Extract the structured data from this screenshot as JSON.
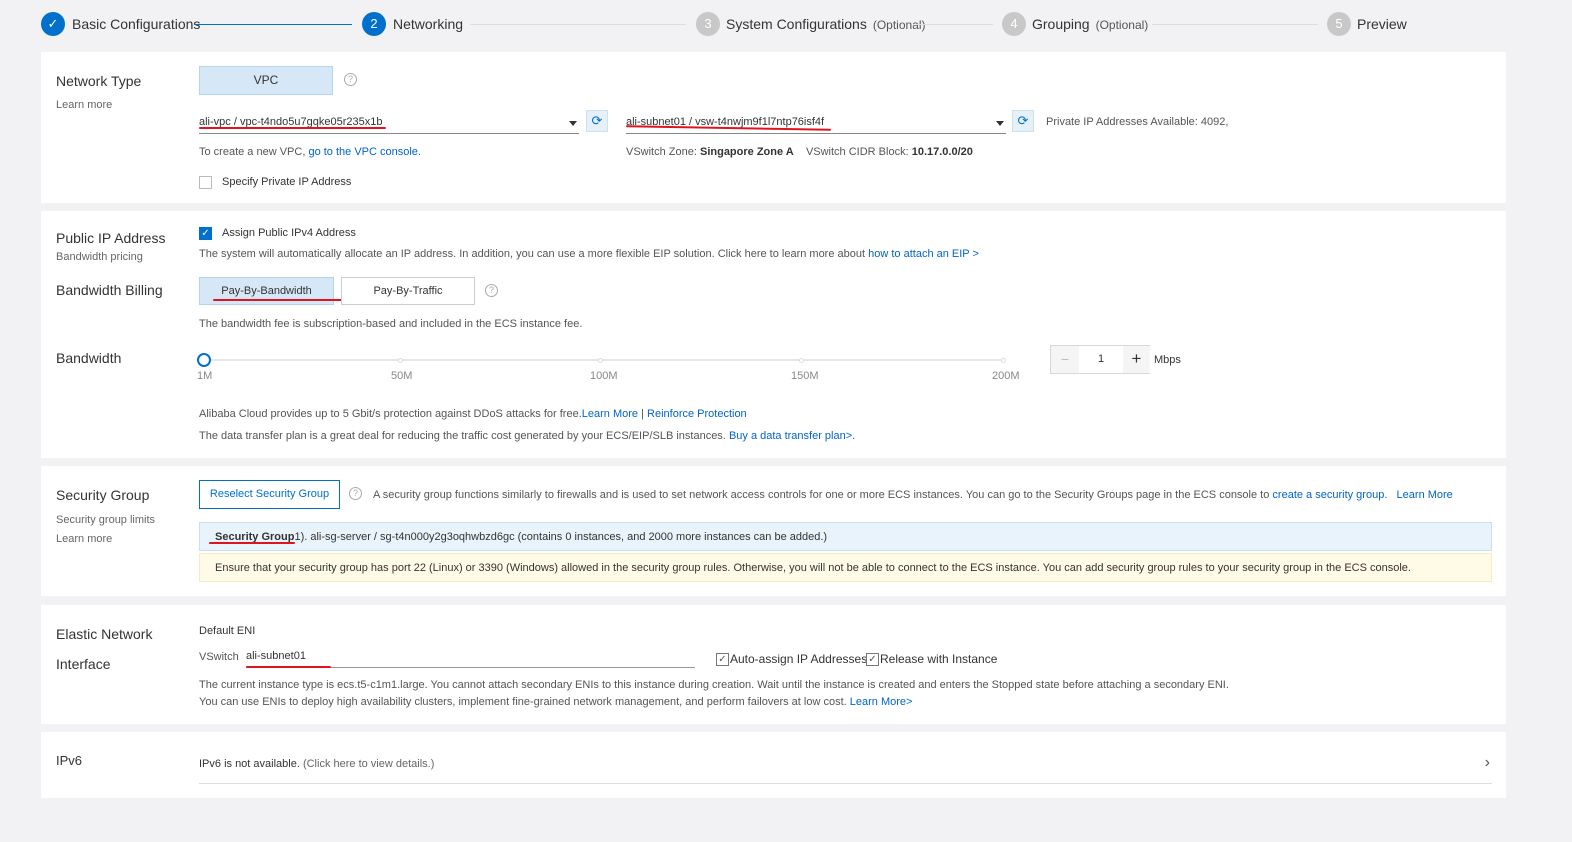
{
  "steps": [
    {
      "num": "",
      "label": "Basic Configurations",
      "optional": ""
    },
    {
      "num": "2",
      "label": "Networking",
      "optional": ""
    },
    {
      "num": "3",
      "label": "System Configurations",
      "optional": "(Optional)"
    },
    {
      "num": "4",
      "label": "Grouping",
      "optional": "(Optional)"
    },
    {
      "num": "5",
      "label": "Preview",
      "optional": ""
    }
  ],
  "network": {
    "label": "Network Type",
    "learn_more": "Learn more",
    "vpc_button": "VPC",
    "vpc_select": "ali-vpc / vpc-t4ndo5u7gqke05r235x1b",
    "vswitch_select": "ali-subnet01 / vsw-t4nwjm9f1l7ntp76isf4f",
    "private_ip_available": "Private IP Addresses Available: 4092,",
    "create_vpc_text": "To create a new VPC,",
    "create_vpc_link": "go to the VPC console.",
    "vswitch_zone_label": "VSwitch Zone:",
    "vswitch_zone_value": "Singapore Zone A",
    "vswitch_cidr_label": "VSwitch CIDR Block:",
    "vswitch_cidr_value": "10.17.0.0/20",
    "specify_private_ip": "Specify Private IP Address"
  },
  "public_ip": {
    "label": "Public IP Address",
    "bandwidth_pricing": "Bandwidth pricing",
    "assign_checkbox": "Assign Public IPv4 Address",
    "eip_text": "The system will automatically allocate an IP address. In addition, you can use a more flexible EIP solution. Click here to learn more about",
    "eip_link": "how to attach an EIP >",
    "billing_label": "Bandwidth Billing",
    "pay_by_bandwidth": "Pay-By-Bandwidth",
    "pay_by_traffic": "Pay-By-Traffic",
    "billing_note": "The bandwidth fee is subscription-based and included in the ECS instance fee.",
    "bandwidth_label": "Bandwidth",
    "slider_ticks": [
      "1M",
      "50M",
      "100M",
      "150M",
      "200M"
    ],
    "bandwidth_value": "1",
    "bandwidth_unit": "Mbps",
    "minus": "−",
    "plus": "+",
    "ddos_text": "Alibaba Cloud provides up to 5 Gbit/s protection against DDoS attacks for free.",
    "ddos_learn_more": "Learn More",
    "separator": "|",
    "reinforce_link": "Reinforce Protection",
    "transfer_text": "The data transfer plan is a great deal for reducing the traffic cost generated by your ECS/EIP/SLB instances.",
    "transfer_link": "Buy a data transfer plan>."
  },
  "security": {
    "label": "Security Group",
    "limits": "Security group limits",
    "learn_more": "Learn more",
    "reselect_button": "Reselect Security Group",
    "info_text": "A security group functions similarly to firewalls and is used to set network access controls for one or more ECS instances. You can go to the Security Groups page in the ECS console to",
    "create_link": "create a security group.",
    "learn_more_link": "Learn More",
    "group_title": "Security Group",
    "group_detail": "1). ali-sg-server / sg-t4n000y2g3oqhwbzd6gc (contains 0 instances, and 2000 more instances can be added.)",
    "warning": "Ensure that your security group has port 22 (Linux) or 3390 (Windows) allowed in the security group rules. Otherwise, you will not be able to connect to the ECS instance. You can add security group rules to your security group in the ECS console."
  },
  "eni": {
    "label_line1": "Elastic Network",
    "label_line2": "Interface",
    "default_eni": "Default ENI",
    "vswitch_label": "VSwitch",
    "vswitch_value": "ali-subnet01",
    "auto_assign": "Auto-assign IP Addresses",
    "release_with_instance": "Release with Instance",
    "note1": "The current instance type is ecs.t5-c1m1.large. You cannot attach secondary ENIs to this instance during creation. Wait until the instance is created and enters the Stopped state before attaching a secondary ENI.",
    "note2": "You can use ENIs to deploy high availability clusters, implement fine-grained network management, and perform failovers at low cost.",
    "note2_link": "Learn More>"
  },
  "ipv6": {
    "label": "IPv6",
    "text": "IPv6 is not available.",
    "hint": "(Click here to view details.)",
    "chevron": "›"
  },
  "colors": {
    "accent": "#0070cc",
    "annotation_red": "#e0141e",
    "warning_bg": "#fffbe6"
  }
}
